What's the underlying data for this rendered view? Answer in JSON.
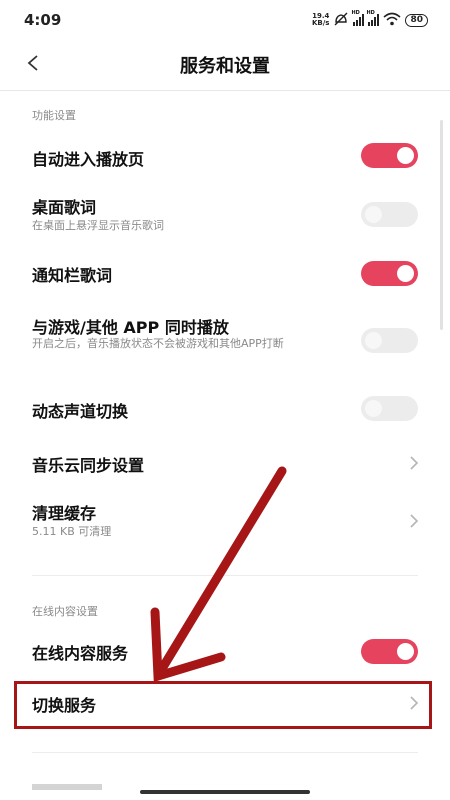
{
  "status_bar": {
    "time": "4:09",
    "net_speed_value": "19.4",
    "net_speed_unit": "KB/s",
    "battery": "80",
    "icons": [
      "network-speed",
      "silent-icon",
      "signal-icon",
      "signal-icon",
      "wifi-icon",
      "battery-icon"
    ]
  },
  "header": {
    "back_icon": "chevron-left-icon",
    "title": "服务和设置"
  },
  "sections": {
    "function": {
      "label": "功能设置",
      "items": [
        {
          "title": "自动进入播放页",
          "subtitle": "",
          "control": "toggle",
          "on": true
        },
        {
          "title": "桌面歌词",
          "subtitle": "在桌面上悬浮显示音乐歌词",
          "control": "toggle",
          "on": false
        },
        {
          "title": "通知栏歌词",
          "subtitle": "",
          "control": "toggle",
          "on": true
        },
        {
          "title": "与游戏/其他 APP 同时播放",
          "subtitle": "开启之后，音乐播放状态不会被游戏和其他APP打断",
          "control": "toggle",
          "on": false
        },
        {
          "title": "动态声道切换",
          "subtitle": "",
          "control": "toggle",
          "on": false
        },
        {
          "title": "音乐云同步设置",
          "subtitle": "",
          "control": "chevron"
        },
        {
          "title": "清理缓存",
          "subtitle": "5.11 KB 可清理",
          "control": "chevron"
        }
      ]
    },
    "online": {
      "label": "在线内容设置",
      "items": [
        {
          "title": "在线内容服务",
          "subtitle": "",
          "control": "toggle",
          "on": true
        },
        {
          "title": "切换服务",
          "subtitle": "",
          "control": "chevron"
        }
      ]
    }
  },
  "colors": {
    "toggle_on": "#e6435f",
    "toggle_off": "#ececec",
    "annotation": "#a61616"
  }
}
